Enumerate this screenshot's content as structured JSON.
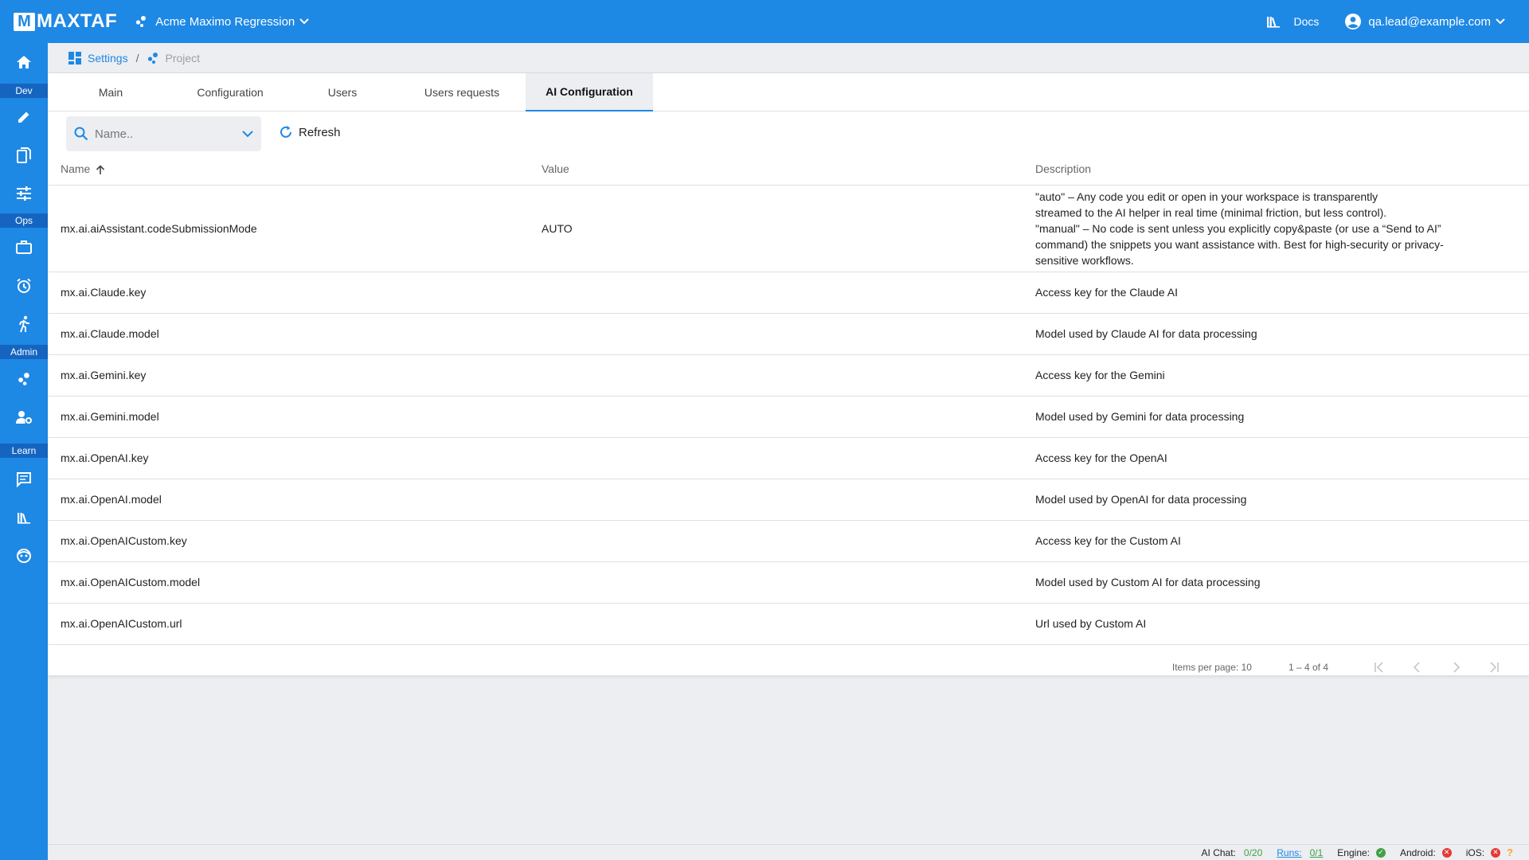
{
  "app": {
    "logo_letter": "M",
    "logo_text": "MAXTAF",
    "project_name": "Acme Maximo Regression",
    "docs_label": "Docs",
    "user_email": "qa.lead@example.com",
    "brand_color": "#1e88e5"
  },
  "sidebar": {
    "sections": [
      "Dev",
      "Ops",
      "Admin",
      "Learn"
    ],
    "icons": [
      "home-icon",
      "pencil-icon",
      "documents-icon",
      "tune-icon",
      "briefcase-icon",
      "alarm-icon",
      "run-icon",
      "project-icon",
      "user-settings-icon",
      "chat-icon",
      "library-icon",
      "support-icon"
    ]
  },
  "breadcrumb": {
    "settings": "Settings",
    "separator": "/",
    "project": "Project"
  },
  "tabs": [
    {
      "label": "Main",
      "active": false
    },
    {
      "label": "Configuration",
      "active": false
    },
    {
      "label": "Users",
      "active": false
    },
    {
      "label": "Users requests",
      "active": false
    },
    {
      "label": "AI Configuration",
      "active": true
    }
  ],
  "toolbar": {
    "search_placeholder": "Name..",
    "refresh_label": "Refresh"
  },
  "table": {
    "columns": {
      "name": "Name",
      "value": "Value",
      "description": "Description"
    },
    "rows": [
      {
        "name": "mx.ai.aiAssistant.codeSubmissionMode",
        "value": "AUTO",
        "description_lines": [
          "\"auto\" – Any code you edit or open in your workspace is transparently",
          "streamed to the AI helper in real time (minimal friction, but less control).",
          "\"manual\" – No code is sent unless you explicitly copy&paste (or use a “Send to AI”",
          "command) the snippets you want assistance with. Best for high-security or privacy-",
          "sensitive workflows."
        ]
      },
      {
        "name": "mx.ai.Claude.key",
        "value": "",
        "description": "Access key for the Claude AI"
      },
      {
        "name": "mx.ai.Claude.model",
        "value": "",
        "description": "Model used by Claude AI for data processing"
      },
      {
        "name": "mx.ai.Gemini.key",
        "value": "",
        "description": "Access key for the Gemini"
      },
      {
        "name": "mx.ai.Gemini.model",
        "value": "",
        "description": "Model used by Gemini for data processing"
      },
      {
        "name": "mx.ai.OpenAI.key",
        "value": "",
        "description": "Access key for the OpenAI"
      },
      {
        "name": "mx.ai.OpenAI.model",
        "value": "",
        "description": "Model used by OpenAI for data processing"
      },
      {
        "name": "mx.ai.OpenAICustom.key",
        "value": "",
        "description": "Access key for the Custom AI"
      },
      {
        "name": "mx.ai.OpenAICustom.model",
        "value": "",
        "description": "Model used by Custom AI for data processing"
      },
      {
        "name": "mx.ai.OpenAICustom.url",
        "value": "",
        "description": "Url used by Custom AI"
      }
    ]
  },
  "paginator": {
    "items_per_page_label": "Items per page:",
    "items_per_page": "10",
    "range": "1 – 4 of 4"
  },
  "statusbar": {
    "ai_chat_label": "AI Chat:",
    "ai_chat_value": "0/20",
    "runs_label": "Runs:",
    "runs_value": "0/1",
    "engine_label": "Engine:",
    "engine_status": "ok",
    "android_label": "Android:",
    "android_status": "error",
    "ios_label": "iOS:",
    "ios_status": "error",
    "help_symbol": "?",
    "ok_color": "#43a047",
    "error_color": "#e53935"
  }
}
